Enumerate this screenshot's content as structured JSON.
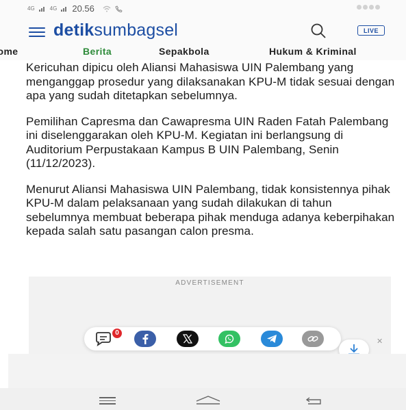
{
  "statusbar": {
    "signal1": "4G",
    "signal2": "4G",
    "time": "20.56"
  },
  "header": {
    "logo_bold": "detik",
    "logo_regular": "sumbagsel",
    "live_label": "LIVE"
  },
  "tabs": [
    {
      "label": "Home",
      "active": false
    },
    {
      "label": "Berita",
      "active": true
    },
    {
      "label": "Sepakbola",
      "active": false
    },
    {
      "label": "Hukum & Kriminal",
      "active": false
    }
  ],
  "article": {
    "paragraphs": [
      "Kericuhan dipicu oleh Aliansi Mahasiswa UIN Palembang yang menganggap prosedur yang dilaksanakan KPU-M tidak sesuai dengan apa yang sudah ditetapkan sebelumnya.",
      "Pemilihan Capresma dan Cawapresma UIN Raden Fatah Palembang ini diselenggarakan oleh KPU-M. Kegiatan ini berlangsung di Auditorium Perpustakaan Kampus B UIN Palembang, Senin (11/12/2023).",
      "Menurut Aliansi Mahasiswa UIN Palembang, tidak konsistennya pihak KPU-M dalam pelaksanaan yang sudah dilakukan di tahun sebelumnya membuat beberapa pihak menduga adanya keberpihakan kepada salah satu pasangan calon presma."
    ]
  },
  "ad": {
    "label": "ADVERTISEMENT"
  },
  "share": {
    "comment_count": "0",
    "icons": [
      "comment-icon",
      "facebook-icon",
      "x-icon",
      "whatsapp-icon",
      "telegram-icon",
      "link-icon"
    ]
  },
  "colors": {
    "brand": "#1d4ea3",
    "active_tab": "#2e8b3a",
    "badge": "#e0272b"
  }
}
